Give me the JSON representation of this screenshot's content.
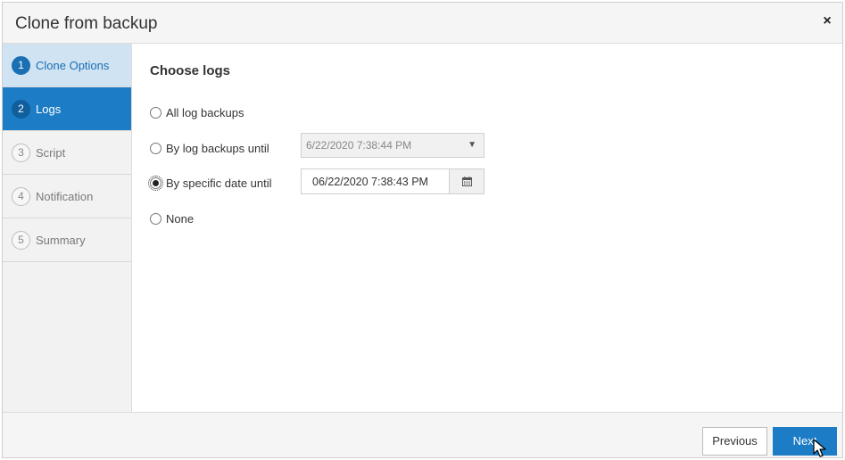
{
  "dialog": {
    "title": "Clone from backup",
    "close_label": "×"
  },
  "steps": [
    {
      "num": "1",
      "label": "Clone Options",
      "state": "done"
    },
    {
      "num": "2",
      "label": "Logs",
      "state": "active"
    },
    {
      "num": "3",
      "label": "Script",
      "state": "pending"
    },
    {
      "num": "4",
      "label": "Notification",
      "state": "pending"
    },
    {
      "num": "5",
      "label": "Summary",
      "state": "pending"
    }
  ],
  "logs": {
    "section_title": "Choose logs",
    "options": [
      {
        "label": "All log backups",
        "checked": false
      },
      {
        "label": "By log backups until",
        "checked": false
      },
      {
        "label": "By specific date until",
        "checked": true
      },
      {
        "label": "None",
        "checked": false
      }
    ],
    "log_backup_select_value": "6/22/2020 7:38:44 PM",
    "specific_date_value": "06/22/2020 7:38:43 PM"
  },
  "footer": {
    "previous_label": "Previous",
    "next_label": "Next"
  },
  "colors": {
    "primary": "#1c7cc6",
    "done_step_bg": "#cfe3f3",
    "sidebar_bg": "#f2f2f2"
  },
  "icons": {
    "close": "close-icon",
    "dropdown": "chevron-down-icon",
    "calendar": "calendar-icon",
    "cursor": "mouse-pointer-icon"
  }
}
